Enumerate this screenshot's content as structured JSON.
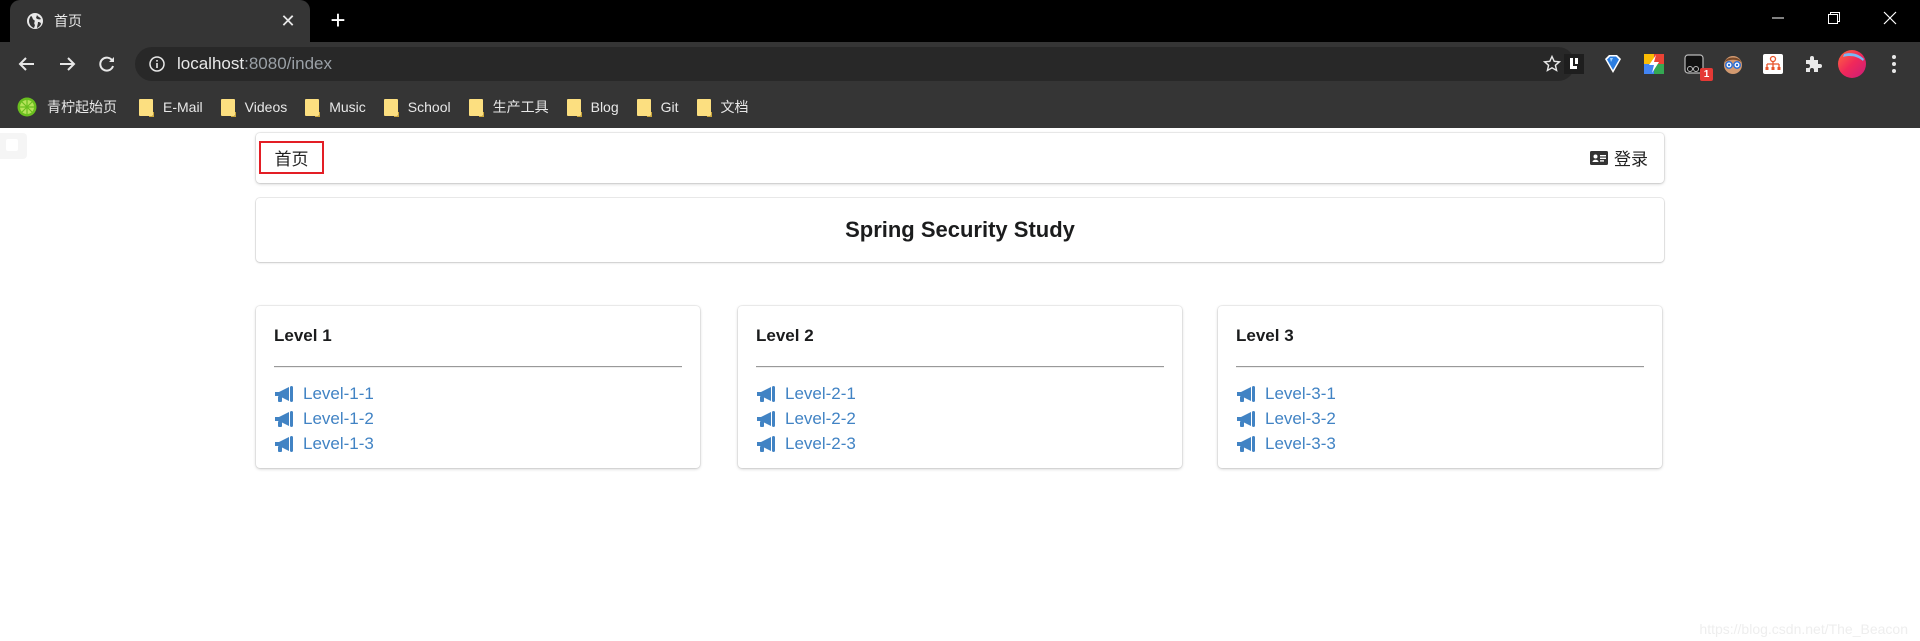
{
  "browser": {
    "tab": {
      "title": "首页",
      "favicon": "globe-icon"
    },
    "new_tab_label": "+",
    "address": {
      "host": "localhost",
      "rest": ":8080/index"
    },
    "extensions": [
      {
        "name": "extension-l-icon"
      },
      {
        "name": "extension-diamond-icon"
      },
      {
        "name": "extension-bolt-icon"
      },
      {
        "name": "extension-glasses-camera-icon",
        "badge": "1"
      },
      {
        "name": "extension-nerd-face-icon"
      },
      {
        "name": "extension-sitemap-icon"
      },
      {
        "name": "extensions-puzzle-icon"
      },
      {
        "name": "profile-avatar"
      },
      {
        "name": "menu-kebab-icon"
      }
    ],
    "bookmarks": [
      {
        "label": "青柠起始页",
        "icon": "lime-icon"
      },
      {
        "label": "E-Mail",
        "icon": "folder-icon"
      },
      {
        "label": "Videos",
        "icon": "folder-icon"
      },
      {
        "label": "Music",
        "icon": "folder-icon"
      },
      {
        "label": "School",
        "icon": "folder-icon"
      },
      {
        "label": "生产工具",
        "icon": "folder-icon"
      },
      {
        "label": "Blog",
        "icon": "folder-icon"
      },
      {
        "label": "Git",
        "icon": "folder-icon"
      },
      {
        "label": "文档",
        "icon": "folder-icon"
      }
    ]
  },
  "page": {
    "menu": {
      "home_label": "首页",
      "login_label": "登录",
      "home_highlight_color": "#e31e25"
    },
    "title": "Spring Security Study",
    "link_color": "#4183c4",
    "cards": [
      {
        "title": "Level 1",
        "links": [
          "Level-1-1",
          "Level-1-2",
          "Level-1-3"
        ]
      },
      {
        "title": "Level 2",
        "links": [
          "Level-2-1",
          "Level-2-2",
          "Level-2-3"
        ]
      },
      {
        "title": "Level 3",
        "links": [
          "Level-3-1",
          "Level-3-2",
          "Level-3-3"
        ]
      }
    ],
    "watermark": "https://blog.csdn.net/The_Beacon"
  }
}
